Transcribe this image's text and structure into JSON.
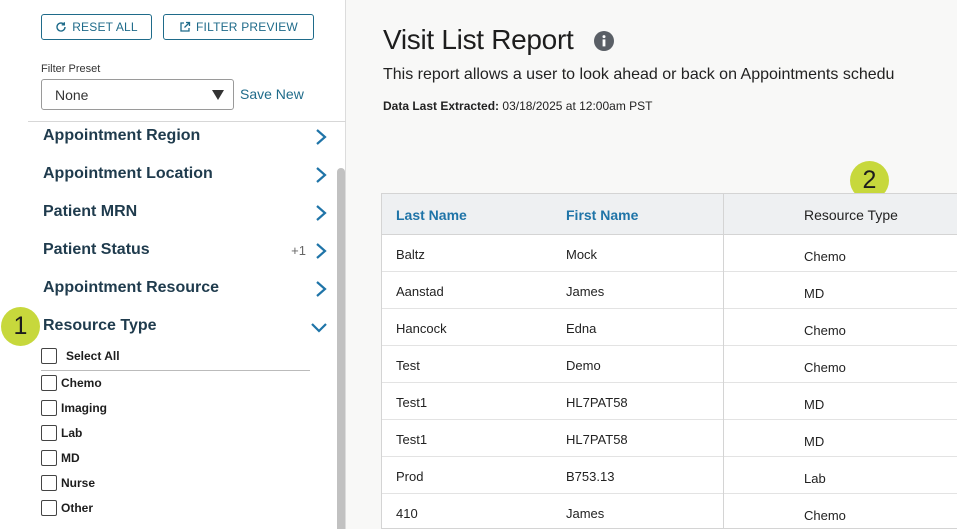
{
  "toolbar": {
    "reset_label": "RESET ALL",
    "preview_label": "FILTER PREVIEW"
  },
  "preset": {
    "label": "Filter Preset",
    "selected": "None",
    "save_new": "Save New"
  },
  "filters": [
    {
      "label": "Appointment Region",
      "count": ""
    },
    {
      "label": "Appointment Location",
      "count": ""
    },
    {
      "label": "Patient MRN",
      "count": ""
    },
    {
      "label": "Patient Status",
      "count": "+1"
    },
    {
      "label": "Appointment Resource",
      "count": ""
    },
    {
      "label": "Resource Type",
      "count": ""
    }
  ],
  "resource_type": {
    "select_all": "Select All",
    "options": [
      "Chemo",
      "Imaging",
      "Lab",
      "MD",
      "Nurse",
      "Other"
    ]
  },
  "badges": [
    "1",
    "2"
  ],
  "page": {
    "title": "Visit List Report",
    "description": "This report allows a user to look ahead or back on Appointments schedu",
    "extracted_label": "Data Last Extracted:",
    "extracted_value": "03/18/2025 at 12:00am PST"
  },
  "table": {
    "headers": [
      "Last Name",
      "First Name",
      "Resource Type"
    ],
    "rows": [
      [
        "Baltz",
        "Mock",
        "Chemo"
      ],
      [
        "Aanstad",
        "James",
        "MD"
      ],
      [
        "Hancock",
        "Edna",
        "Chemo"
      ],
      [
        "Test",
        "Demo",
        "Chemo"
      ],
      [
        "Test1",
        "HL7PAT58",
        "MD"
      ],
      [
        "Test1",
        "HL7PAT58",
        "MD"
      ],
      [
        "Prod",
        "B753.13",
        "Lab"
      ],
      [
        "410",
        "James",
        "Chemo"
      ]
    ]
  },
  "colors": {
    "accent": "#1f6b8a",
    "header_link": "#1f74a8",
    "badge": "#c7d83c"
  }
}
